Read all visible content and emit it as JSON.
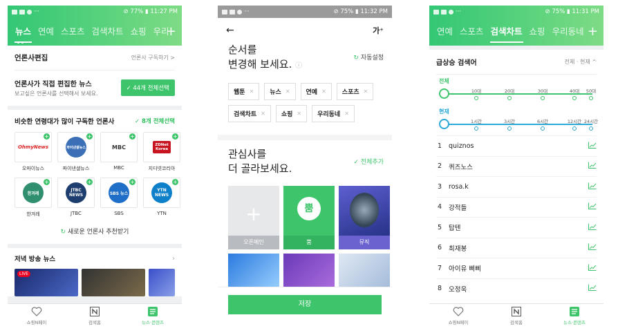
{
  "phone1": {
    "status": {
      "battery": "77%",
      "time": "11:27 PM"
    },
    "tabs": [
      "뉴스",
      "연예",
      "스포츠",
      "검색차트",
      "쇼핑",
      "우리"
    ],
    "active_tab_index": 0,
    "section_title": "언론사편집",
    "subscribe_link": "언론사 구독하기 >",
    "edit_title": "언론사가 직접 편집한 뉴스",
    "edit_sub": "보고싶은 언론사를 선택해서 보세요.",
    "select_all_button": "✓ 44개 전체선택",
    "recommend_title": "비슷한 연령대가 많이 구독한 언론사",
    "recommend_select": "✓ 8개 전체선택",
    "publishers": [
      {
        "name": "오마이뉴스",
        "logo": "OhmyNews",
        "color": "#e8e8e8"
      },
      {
        "name": "파이낸셜뉴스",
        "logo": "파이낸셜뉴스",
        "color": "#3b6fb6"
      },
      {
        "name": "MBC",
        "logo": "MBC",
        "color": "#ffffff"
      },
      {
        "name": "지디넷코리아",
        "logo": "ZDNet Korea",
        "color": "#ffffff"
      },
      {
        "name": "한겨레",
        "logo": "한겨레",
        "color": "#2f8f6f"
      },
      {
        "name": "JTBC",
        "logo": "JTBC NEWS",
        "color": "#1d3d6e"
      },
      {
        "name": "SBS",
        "logo": "SBS 뉴스",
        "color": "#1f6fc8"
      },
      {
        "name": "YTN",
        "logo": "YTN NEWS",
        "color": "#0e7fc9"
      }
    ],
    "refresh_label": "새로운 언론사 추천받기",
    "evening_news_title": "저녁 방송 뉴스",
    "live_badge": "LIVE",
    "bottom_nav": [
      "쇼핑N페이",
      "검색홈",
      "뉴스·콘텐츠"
    ]
  },
  "phone2": {
    "status": {
      "battery": "75%",
      "time": "11:32 PM"
    },
    "font_size_label": "가⁺",
    "order_title_1": "순서를",
    "order_title_2": "변경해 보세요.",
    "auto_setting": "자동설정",
    "chips": [
      "웹툰",
      "뉴스",
      "연예",
      "스포츠",
      "검색차트",
      "쇼핑",
      "우리동네"
    ],
    "interest_title_1": "관심사를",
    "interest_title_2": "더 골라보세요.",
    "add_all": "✓ 전체추가",
    "tiles": [
      {
        "label": "오픈메인",
        "type": "add"
      },
      {
        "label": "뿜",
        "type": "bbom"
      },
      {
        "label": "뮤직",
        "type": "music"
      }
    ],
    "save_button": "저장"
  },
  "phone3": {
    "status": {
      "battery": "75%",
      "time": "11:31 PM"
    },
    "tabs": [
      "연예",
      "스포츠",
      "검색차트",
      "쇼핑",
      "우리동네"
    ],
    "active_tab_index": 2,
    "chart_title": "급상승 검색어",
    "scope_label": "전체 · 현재 ^",
    "age_filter": {
      "label": "전체",
      "stops": [
        "10대",
        "20대",
        "30대",
        "40대",
        "50대"
      ]
    },
    "time_filter": {
      "label": "현재",
      "stops": [
        "1시간",
        "3시간",
        "6시간",
        "12시간",
        "24시간"
      ]
    },
    "ranking": [
      "quiznos",
      "퀴즈노스",
      "rosa.k",
      "강적들",
      "탑텐",
      "최재봉",
      "아이유 삐삐",
      "오정욱"
    ],
    "bottom_nav": [
      "쇼핑N페이",
      "검색홈",
      "뉴스·콘텐츠"
    ]
  },
  "colors": {
    "accent": "#3ec56b",
    "filter_age": "#3ec56b",
    "filter_time": "#2aa8d8"
  }
}
